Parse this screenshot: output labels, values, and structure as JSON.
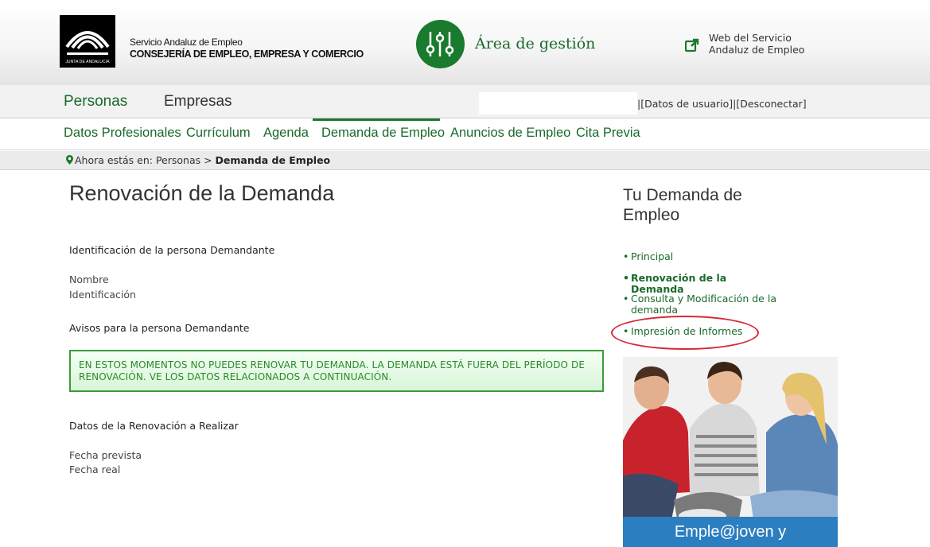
{
  "header": {
    "logo_caption": "JUNTA DE ANDALUCIA",
    "org_line1": "Servicio Andaluz de Empleo",
    "org_line2": "CONSEJERÍA DE EMPLEO, EMPRESA Y COMERCIO",
    "area_title": "Área de gestión",
    "web_link_line1": "Web del Servicio",
    "web_link_line2": "Andaluz de Empleo",
    "brand_color": "#1a7a2d"
  },
  "top_nav": {
    "tabs": [
      {
        "label": "Personas",
        "active": true
      },
      {
        "label": "Empresas",
        "active": false
      }
    ],
    "user_data_link": "[Datos de usuario]",
    "separator": "|",
    "logout_link": "[Desconectar]"
  },
  "sub_nav": {
    "items": [
      {
        "label": "Datos Profesionales"
      },
      {
        "label": "Currículum"
      },
      {
        "label": "Agenda"
      },
      {
        "label": "Demanda de Empleo",
        "active": true
      },
      {
        "label": "Anuncios de Empleo"
      },
      {
        "label": "Cita Previa"
      }
    ]
  },
  "breadcrumb": {
    "prefix": "Ahora estás en: Personas > ",
    "current": "Demanda de Empleo"
  },
  "main": {
    "title": "Renovación de la Demanda",
    "identification_section": "Identificación de la persona Demandante",
    "name_label": "Nombre",
    "id_label": "Identificación",
    "notices_section": "Avisos para la persona Demandante",
    "notice_text": "EN ESTOS MOMENTOS NO PUEDES RENOVAR TU DEMANDA. LA DEMANDA ESTÁ FUERA DEL PERÍODO DE RENOVACIÓN. VE LOS DATOS RELACIONADOS A CONTINUACIÓN.",
    "renewal_section": "Datos de la Renovación a Realizar",
    "expected_date_label": "Fecha prevista",
    "actual_date_label": "Fecha real"
  },
  "sidebar": {
    "title": "Tu Demanda de Empleo",
    "bullet": "•",
    "items": [
      {
        "label": "Principal"
      },
      {
        "label": "Renovación de la Demanda",
        "active": true
      },
      {
        "label": "Consulta y Modificación de la demanda"
      },
      {
        "label": "Impresión de Informes",
        "highlighted": true
      }
    ],
    "highlight_color": "#d62839",
    "promo_caption": "Emple@joven y"
  }
}
